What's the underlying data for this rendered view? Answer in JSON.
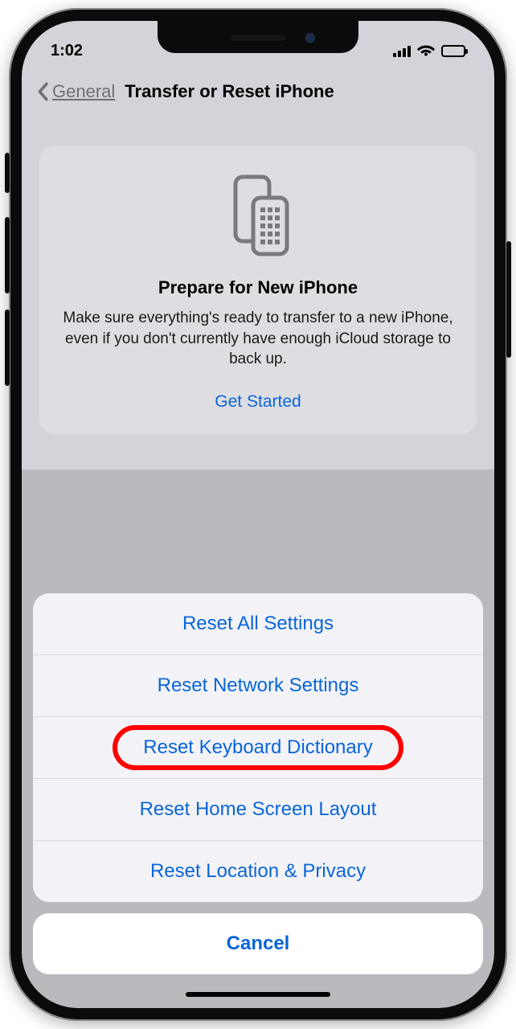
{
  "statusbar": {
    "time": "1:02"
  },
  "nav": {
    "back": "General",
    "title": "Transfer or Reset iPhone"
  },
  "card": {
    "title": "Prepare for New iPhone",
    "text": "Make sure everything's ready to transfer to a new iPhone, even if you don't currently have enough iCloud storage to back up.",
    "cta": "Get Started"
  },
  "sheet": {
    "items": [
      "Reset All Settings",
      "Reset Network Settings",
      "Reset Keyboard Dictionary",
      "Reset Home Screen Layout",
      "Reset Location & Privacy"
    ],
    "cancel": "Cancel",
    "highlighted_index": 2
  }
}
